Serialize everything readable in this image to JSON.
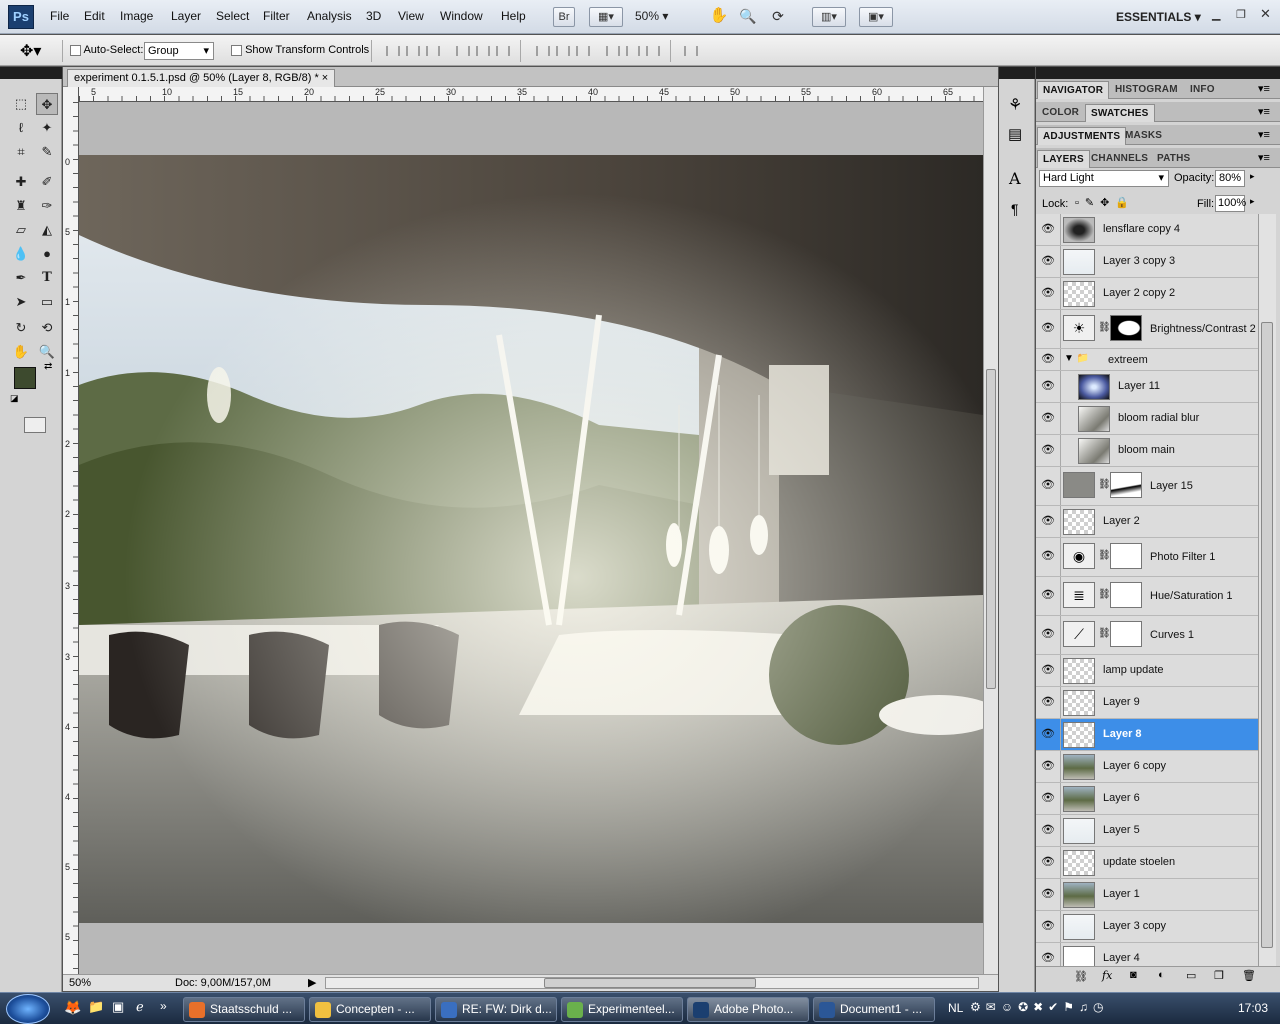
{
  "app": {
    "logo": "Ps",
    "workspace": "ESSENTIALS",
    "zoom_box": "50%"
  },
  "menus": [
    "File",
    "Edit",
    "Image",
    "Layer",
    "Select",
    "Filter",
    "Analysis",
    "3D",
    "View",
    "Window",
    "Help"
  ],
  "top_icons": [
    "br-icon",
    "screen-mode-icon",
    "hand-icon",
    "zoom-icon",
    "rotate-view-icon",
    "arrange-icon",
    "screen-icon"
  ],
  "options": {
    "auto_select_label": "Auto-Select:",
    "auto_select_value": "Group",
    "transform_label": "Show Transform Controls"
  },
  "document": {
    "tab_title": "experiment 0.1.5.1.psd @ 50% (Layer 8, RGB/8) *",
    "ruler_h": [
      "5",
      "10",
      "15",
      "20",
      "25",
      "30",
      "35",
      "40",
      "45",
      "50",
      "55",
      "60",
      "65"
    ],
    "ruler_v": [
      "0",
      "5",
      "1",
      "1",
      "2",
      "2",
      "3",
      "3",
      "4",
      "4",
      "5",
      "5"
    ],
    "status_zoom": "50%",
    "doc_size": "Doc: 9,00M/157,0M"
  },
  "panel_tabs": {
    "row1": [
      "NAVIGATOR",
      "HISTOGRAM",
      "INFO"
    ],
    "row2": [
      "COLOR",
      "SWATCHES"
    ],
    "row3": [
      "ADJUSTMENTS",
      "MASKS"
    ],
    "row4": [
      "LAYERS",
      "CHANNELS",
      "PATHS"
    ]
  },
  "layers_panel": {
    "blend_mode": "Hard Light",
    "opacity_label": "Opacity:",
    "opacity_value": "80%",
    "lock_label": "Lock:",
    "fill_label": "Fill:",
    "fill_value": "100%",
    "layers": [
      {
        "name": "lensflare copy 4",
        "kind": "dark"
      },
      {
        "name": "Layer 3 copy 3",
        "kind": "sky"
      },
      {
        "name": "Layer 2 copy 2",
        "kind": "checker"
      },
      {
        "name": "Brightness/Contrast 2",
        "kind": "adj-bc"
      },
      {
        "name": "extreem",
        "kind": "group"
      },
      {
        "name": "Layer 11",
        "kind": "glow"
      },
      {
        "name": "bloom radial blur",
        "kind": "bloom"
      },
      {
        "name": "bloom main",
        "kind": "bloom"
      },
      {
        "name": "Layer 15",
        "kind": "texture-mask"
      },
      {
        "name": "Layer 2",
        "kind": "checker"
      },
      {
        "name": "Photo Filter 1",
        "kind": "adj-photo"
      },
      {
        "name": "Hue/Saturation 1",
        "kind": "adj-hue"
      },
      {
        "name": "Curves 1",
        "kind": "adj-curves"
      },
      {
        "name": "lamp update",
        "kind": "checker"
      },
      {
        "name": "Layer 9",
        "kind": "checker"
      },
      {
        "name": "Layer 8",
        "kind": "checker",
        "selected": true
      },
      {
        "name": "Layer 6 copy",
        "kind": "scene"
      },
      {
        "name": "Layer 6",
        "kind": "scene"
      },
      {
        "name": "Layer 5",
        "kind": "sky"
      },
      {
        "name": "update stoelen",
        "kind": "checker"
      },
      {
        "name": "Layer 1",
        "kind": "scene"
      },
      {
        "name": "Layer 3 copy",
        "kind": "sky"
      },
      {
        "name": "Layer 4",
        "kind": "white"
      }
    ]
  },
  "taskbar": {
    "tasks": [
      {
        "label": "Staatsschuld ...",
        "color": "#e8702a"
      },
      {
        "label": "Concepten - ...",
        "color": "#f0c040"
      },
      {
        "label": "RE: FW: Dirk d...",
        "color": "#3a6fc0"
      },
      {
        "label": "Experimenteel...",
        "color": "#6ab04c"
      },
      {
        "label": "Adobe Photo...",
        "color": "#1b3f70",
        "active": true
      },
      {
        "label": "Document1 - ...",
        "color": "#2b5797"
      }
    ],
    "language": "NL",
    "clock": "17:03"
  }
}
